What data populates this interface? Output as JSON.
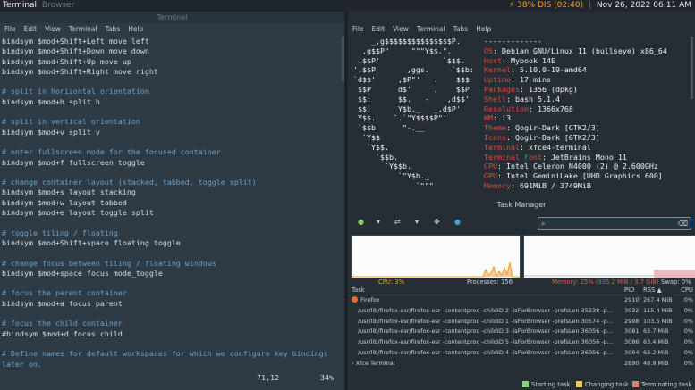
{
  "topbar": {
    "app": "Terminal",
    "app2": "Browser",
    "battery": "38% DIS (02:40)",
    "datetime": "Nov 26, 2022 06:11 AM"
  },
  "left_terminal": {
    "title": "Terminal",
    "menu": [
      "File",
      "Edit",
      "View",
      "Terminal",
      "Tabs",
      "Help"
    ],
    "lines": [
      [
        "t",
        "bindsym $mod+Shift+Left move left"
      ],
      [
        "t",
        "bindsym $mod+Shift+Down move down"
      ],
      [
        "t",
        "bindsym $mod+Shift+Up move up"
      ],
      [
        "t",
        "bindsym $mod+Shift+Right move right"
      ],
      [
        "t",
        ""
      ],
      [
        "c",
        "# split in horizontal orientation"
      ],
      [
        "t",
        "bindsym $mod+h split h"
      ],
      [
        "t",
        ""
      ],
      [
        "c",
        "# split in vertical orientation"
      ],
      [
        "t",
        "bindsym $mod+v split v"
      ],
      [
        "t",
        ""
      ],
      [
        "c",
        "# enter fullscreen mode for the focused container"
      ],
      [
        "t",
        "bindsym $mod+f fullscreen toggle"
      ],
      [
        "t",
        ""
      ],
      [
        "c",
        "# change container layout (stacked, tabbed, toggle split)"
      ],
      [
        "t",
        "bindsym $mod+s layout stacking"
      ],
      [
        "t",
        "bindsym $mod+w layout tabbed"
      ],
      [
        "t",
        "bindsym $mod+e layout toggle split"
      ],
      [
        "t",
        ""
      ],
      [
        "c",
        "# toggle tiling / floating"
      ],
      [
        "t",
        "bindsym $mod+Shift+space floating toggle"
      ],
      [
        "t",
        ""
      ],
      [
        "c",
        "# change focus between tiling / floating windows"
      ],
      [
        "t",
        "bindsym $mod+space focus mode_toggle"
      ],
      [
        "t",
        ""
      ],
      [
        "c",
        "# focus the parent container"
      ],
      [
        "t",
        "bindsym $mod+a focus parent"
      ],
      [
        "t",
        ""
      ],
      [
        "c",
        "# focus the child container"
      ],
      [
        "t",
        "#bindsym $mod+d focus child"
      ],
      [
        "t",
        ""
      ],
      [
        "c",
        "# Define names for default workspaces for which we configure key bindings"
      ],
      [
        "c",
        "later on."
      ]
    ],
    "cursor_pos": "71,12",
    "scroll_pct": "34%"
  },
  "right_terminal": {
    "menu": [
      "File",
      "Edit",
      "View",
      "Terminal",
      "Tabs",
      "Help"
    ],
    "logo": [
      [
        "w",
        "    _,g$$$$$$$$$$$$$$$P."
      ],
      [
        "w",
        "  ,g$$P\"     \"\"\"Y$$.\"."
      ],
      [
        "w",
        " ,$$P'              `$$$."
      ],
      [
        "w",
        "',$$P       ,ggs.     `$$b:"
      ],
      [
        "w",
        "`d$$'     ,$P\"'   .    $$$"
      ],
      [
        "w",
        " $$P      d$'     ,    $$P"
      ],
      [
        "w",
        " $$:      $$.   -    ,d$$'"
      ],
      [
        "w",
        " $$;      Y$b._   _,d$P'"
      ],
      [
        "w",
        " Y$$.    `.`\"Y$$$$P\"'"
      ],
      [
        "w",
        " `$$b      \"-.__"
      ],
      [
        "w",
        "  `Y$$"
      ],
      [
        "w",
        "   `Y$$."
      ],
      [
        "w",
        "     `$$b."
      ],
      [
        "w",
        "       `Y$$b."
      ],
      [
        "w",
        "          `\"Y$b._"
      ],
      [
        "w",
        "              `\"\"\""
      ]
    ],
    "separator": "-------------",
    "info": [
      [
        "OS",
        "Debian GNU/Linux 11 (bullseye) x86_64"
      ],
      [
        "Host",
        "Mybook 14E"
      ],
      [
        "Kernel",
        "5.10.0-19-amd64"
      ],
      [
        "Uptime",
        "17 mins"
      ],
      [
        "Packages",
        "1356 (dpkg)"
      ],
      [
        "Shell",
        "bash 5.1.4"
      ],
      [
        "Resolution",
        "1366x768"
      ],
      [
        "WM",
        "i3"
      ],
      [
        "Theme",
        "Qogir-Dark [GTK2/3]"
      ],
      [
        "Icons",
        "Qogir-Dark [GTK2/3]"
      ],
      [
        "Terminal",
        "xfce4-terminal"
      ],
      [
        "Terminal Font",
        "JetBrains Mono 11"
      ],
      [
        "CPU",
        "Intel Celeron N4000 (2) @ 2.600GHz"
      ],
      [
        "GPU",
        "Intel GeminiLake [UHD Graphics 600]"
      ],
      [
        "Memory",
        "691MiB / 3749MiB"
      ]
    ]
  },
  "task_manager": {
    "title": "Task Manager",
    "search_value": "",
    "cpu": "CPU: 3%",
    "processes": "Processes: 156",
    "memory": "Memory: 25% (935.2 MiB / 3.7 GiB)",
    "swap": "Swap: 0%",
    "columns": {
      "task": "Task",
      "pid": "PID",
      "rss": "RSS",
      "sort": "▲",
      "cpu": "CPU"
    },
    "rows": [
      {
        "task": "Firefox",
        "pid": "2910",
        "rss": "267.4 MiB",
        "cpu": "0%",
        "icon": "firefox-icon"
      },
      {
        "task": "/usr/lib/firefox-esr/firefox-esr -contentproc -childID 2 -isForBrowser -prefsLen 35238 -p...",
        "pid": "3032",
        "rss": "115.4 MiB",
        "cpu": "0%"
      },
      {
        "task": "/usr/lib/firefox-esr/firefox-esr -contentproc -childID 1 -isForBrowser -prefsLen 30574 -p...",
        "pid": "2998",
        "rss": "103.5 MiB",
        "cpu": "0%"
      },
      {
        "task": "/usr/lib/firefox-esr/firefox-esr -contentproc -childID 3 -isForBrowser -prefsLen 36056 -p...",
        "pid": "3081",
        "rss": "63.7 MiB",
        "cpu": "0%"
      },
      {
        "task": "/usr/lib/firefox-esr/firefox-esr -contentproc -childID 5 -isForBrowser -prefsLen 36056 -p...",
        "pid": "3086",
        "rss": "63.4 MiB",
        "cpu": "0%"
      },
      {
        "task": "/usr/lib/firefox-esr/firefox-esr -contentproc -childID 4 -isForBrowser -prefsLen 36056 -p...",
        "pid": "3084",
        "rss": "63.2 MiB",
        "cpu": "0%"
      },
      {
        "task": "Xfce Terminal",
        "pid": "2890",
        "rss": "48.9 MiB",
        "cpu": "0%"
      }
    ],
    "legend": [
      {
        "label": "Starting task",
        "color": "#8bd36a"
      },
      {
        "label": "Changing task",
        "color": "#f3c766"
      },
      {
        "label": "Terminating task",
        "color": "#e77b70"
      }
    ]
  }
}
